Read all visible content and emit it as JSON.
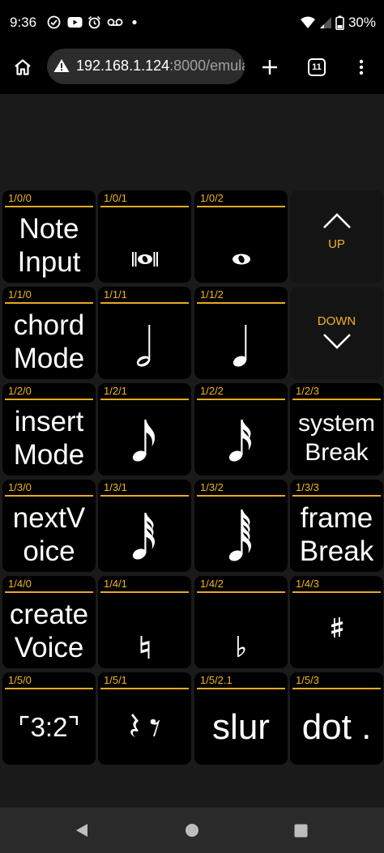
{
  "status_bar": {
    "time": "9:36",
    "battery": "30%",
    "icons": [
      "check-circle-icon",
      "youtube-icon",
      "alarm-icon",
      "voicemail-icon",
      "dot-icon",
      "wifi-icon",
      "signal-icon",
      "battery-icon"
    ]
  },
  "browser": {
    "url_host": "192.168.1.124",
    "url_rest": ":8000/emula",
    "tab_count": "11"
  },
  "grid": {
    "cells": [
      {
        "label": "1/0/0",
        "text": "Note\nInput"
      },
      {
        "label": "1/0/1",
        "symbol": "breve-icon"
      },
      {
        "label": "1/0/2",
        "symbol": "whole-note-icon"
      },
      {
        "nav": "UP"
      },
      {
        "label": "1/1/0",
        "text": "chord\nMode"
      },
      {
        "label": "1/1/1",
        "symbol": "half-note-icon"
      },
      {
        "label": "1/1/2",
        "symbol": "quarter-note-icon"
      },
      {
        "nav": "DOWN"
      },
      {
        "label": "1/2/0",
        "text": "insert\nMode"
      },
      {
        "label": "1/2/1",
        "symbol": "eighth-note-icon"
      },
      {
        "label": "1/2/2",
        "symbol": "sixteenth-note-icon"
      },
      {
        "label": "1/2/3",
        "text": "system\nBreak"
      },
      {
        "label": "1/3/0",
        "text": "nextV\noice"
      },
      {
        "label": "1/3/1",
        "symbol": "thirty-second-note-icon"
      },
      {
        "label": "1/3/2",
        "symbol": "sixty-fourth-note-icon"
      },
      {
        "label": "1/3/3",
        "text": "frame\nBreak"
      },
      {
        "label": "1/4/0",
        "text": "create\nVoice"
      },
      {
        "label": "1/4/1",
        "symbol": "natural-icon"
      },
      {
        "label": "1/4/2",
        "symbol": "flat-icon"
      },
      {
        "label": "1/4/3",
        "symbol": "sharp-icon"
      },
      {
        "label": "1/5/0",
        "text": "⌜3:2⌝"
      },
      {
        "label": "1/5/1",
        "symbol": "rests-icon"
      },
      {
        "label": "1/5/2.1",
        "text": "slur"
      },
      {
        "label": "1/5/3",
        "text": "dot ."
      }
    ]
  }
}
